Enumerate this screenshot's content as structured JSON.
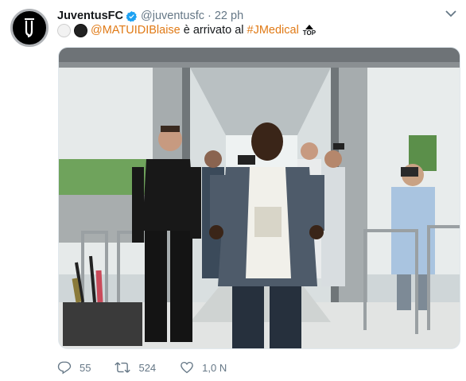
{
  "account": {
    "display_name": "JuventusFC",
    "handle": "@juventusfc",
    "time_ago": "22 ph",
    "verified_icon": "verified-badge-icon",
    "avatar_icon": "juventus-logo-icon"
  },
  "tweet": {
    "mention": "@MATUIDIBlaise",
    "text_middle": "è arrivato al",
    "hashtag": "#JMedical",
    "top_emoji_label": "TOP"
  },
  "stats": {
    "replies": "55",
    "retweets": "524",
    "likes": "1,0 N"
  },
  "colors": {
    "link": "#e07a16",
    "muted": "#657786",
    "verified": "#1da1f2"
  }
}
